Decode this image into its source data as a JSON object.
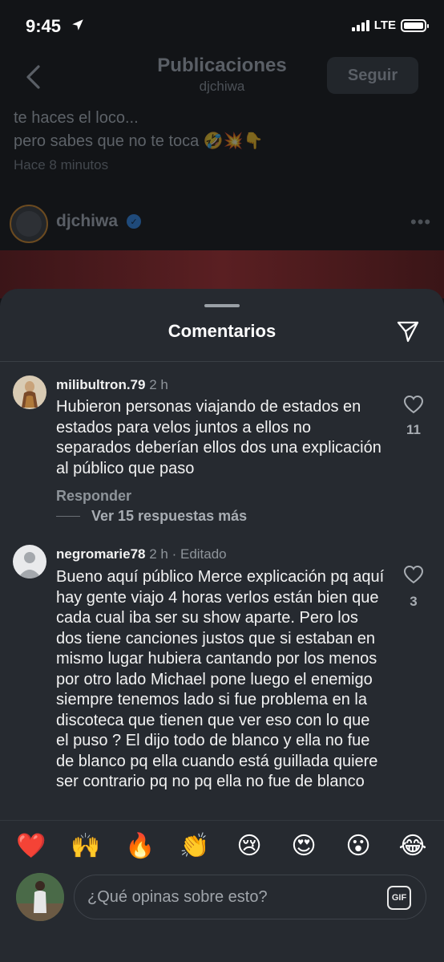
{
  "status_bar": {
    "time": "9:45",
    "network": "LTE",
    "battery_level": 1.0
  },
  "header": {
    "title": "Publicaciones",
    "subtitle": "djchiwa",
    "follow_label": "Seguir"
  },
  "post": {
    "caption_line_1": "te haces el loco...",
    "caption_line_2": "pero sabes que no te toca",
    "caption_emojis": "🤣💥👇",
    "time_ago": "Hace 8 minutos",
    "author": "djchiwa",
    "more_label": "•••"
  },
  "sheet": {
    "title": "Comentarios",
    "comments": [
      {
        "username": "milibultron.79",
        "meta": "2 h",
        "text": "Hubieron personas viajando de estados en estados para velos juntos a ellos no separados deberían ellos dos una explicación al público que paso",
        "likes": "11",
        "reply_label": "Responder",
        "view_replies_label": "Ver 15 respuestas más"
      },
      {
        "username": "negromarie78",
        "meta": "2 h · Editado",
        "text": "Bueno aquí público Merce explicación pq aquí hay gente viajo 4 horas verlos están bien que cada cual iba ser su show aparte. Pero los dos tiene canciones justos que si estaban en mismo lugar hubiera cantando  por los menos por otro lado Michael pone luego el enemigo siempre tenemos lado si fue problema en la discoteca que tienen que ver eso con lo que el puso ? El dijo todo de blanco y ella no fue de blanco pq ella cuando está guillada quiere ser contrario pq no pq ella no fue de blanco",
        "likes": "3"
      }
    ],
    "reactions": [
      "❤️",
      "🙌",
      "🔥",
      "👏",
      "😢",
      "😍",
      "😮",
      "😂"
    ],
    "composer": {
      "placeholder": "¿Qué opinas sobre esto?",
      "gif_label": "GIF"
    }
  }
}
